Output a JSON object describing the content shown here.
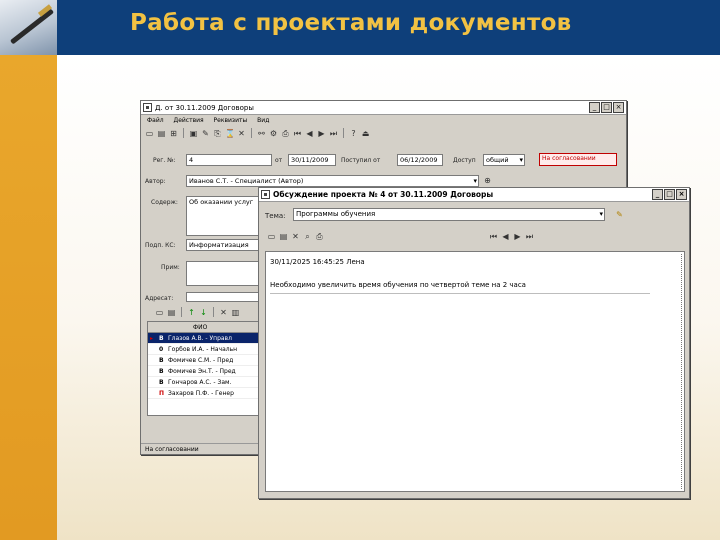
{
  "slide": {
    "title": "Работа с проектами документов"
  },
  "back_window": {
    "title": "Д. от 30.11.2009 Договоры",
    "menu": [
      "Файл",
      "Действия",
      "Реквизиты",
      "Вид"
    ],
    "fields": {
      "reg_label": "Рег. №:",
      "reg_value": "4",
      "from_label": "от",
      "from_value": "30/11/2009",
      "delivered_label": "Поступил от",
      "delivered_value": "06/12/2009",
      "access_label": "Доступ",
      "access_value": "общий",
      "status_value": "На согласовании",
      "author_label": "Автор:",
      "author_value": "Иванов С.Т. - Специалист (Автор)",
      "subject_label": "Содерж:",
      "subject_value": "Об оказании услуг",
      "signer_label": "Подп. КС:",
      "signer_value": "Информатизация",
      "note_label": "Прим:",
      "addr_label": "Адресат:"
    },
    "grid": {
      "header": "ФИО",
      "rows": [
        {
          "state": "В",
          "text": "Глазов А.В. - Управл"
        },
        {
          "state": "0",
          "text": "Горбов И.А. - Начальн"
        },
        {
          "state": "В",
          "text": "Фомичев С.М. - Пред"
        },
        {
          "state": "В",
          "text": "Фомичев Эн.Т. - Пред"
        },
        {
          "state": "В",
          "text": "Гончаров А.С. - Зам."
        },
        {
          "state": "П",
          "text": "Захаров П.Ф. - Генер"
        }
      ]
    },
    "status_bar": "На согласовании"
  },
  "front_window": {
    "title": "Обсуждение проекта № 4 от 30.11.2009 Договоры",
    "topic_label": "Тема:",
    "topic_value": "Программы обучения",
    "message_header": "30/11/2025 16:45:25 Лена",
    "message_body": "Необходимо увеличить время обучения по четвертой теме на 2 часа"
  }
}
